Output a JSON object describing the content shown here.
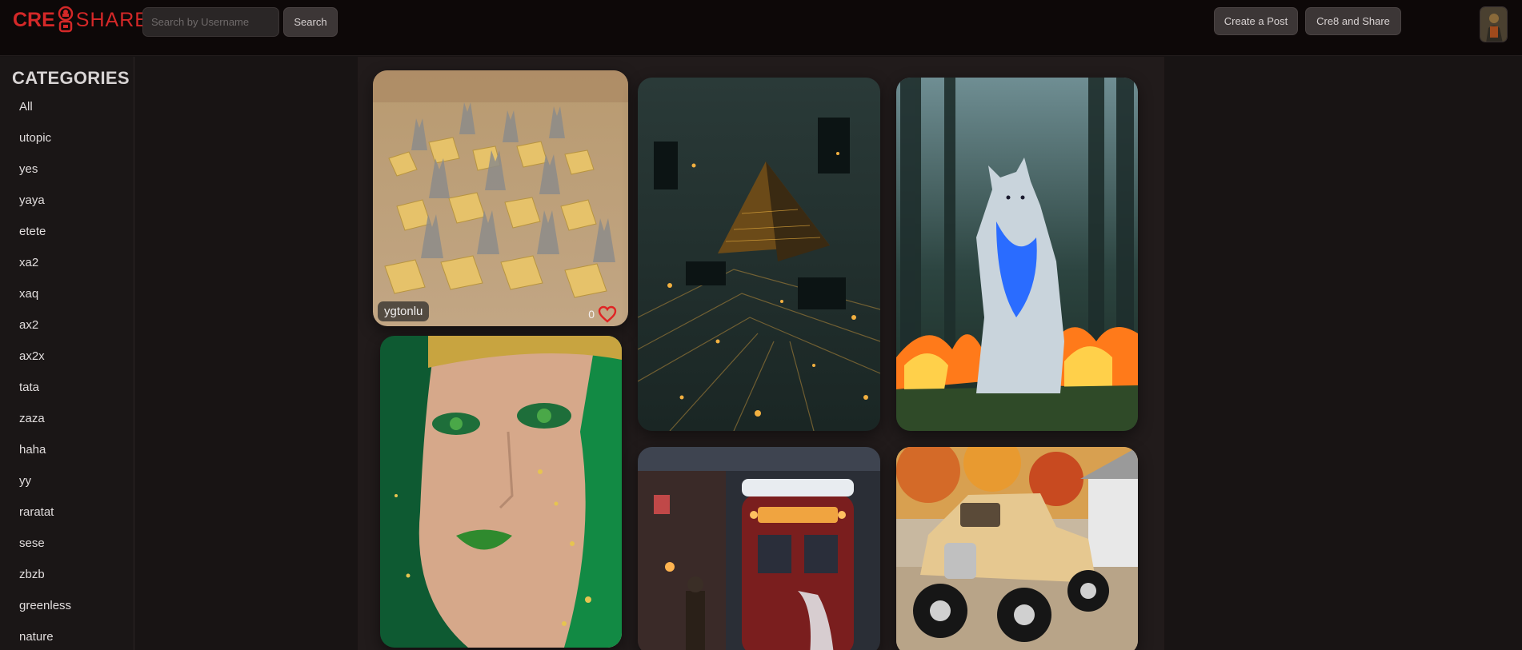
{
  "header": {
    "logo_part1": "CRE",
    "logo_part2": "SHARE",
    "search_placeholder": "Search by Username",
    "search_value": "",
    "search_button": "Search",
    "create_post_button": "Create a Post",
    "cre8_share_button": "Cre8 and Share",
    "brand_color": "#d42828"
  },
  "sidebar": {
    "title": "CATEGORIES",
    "items": [
      "All",
      "utopic",
      "yes",
      "yaya",
      "etete",
      "xa2",
      "xaq",
      "ax2",
      "ax2x",
      "tata",
      "zaza",
      "haha",
      "yy",
      "raratat",
      "sese",
      "zbzb",
      "greenless",
      "nature"
    ]
  },
  "feed": {
    "posts": [
      {
        "image": "cheese-cats-field",
        "username": "ygtonlu",
        "likes": "0",
        "like_icon": "heart-icon"
      },
      {
        "image": "circuit-pyramid"
      },
      {
        "image": "blue-wolf-in-forest-fire"
      },
      {
        "image": "green-glitter-face"
      },
      {
        "image": "red-snowy-train"
      },
      {
        "image": "peanut-hot-rod-car"
      }
    ]
  }
}
